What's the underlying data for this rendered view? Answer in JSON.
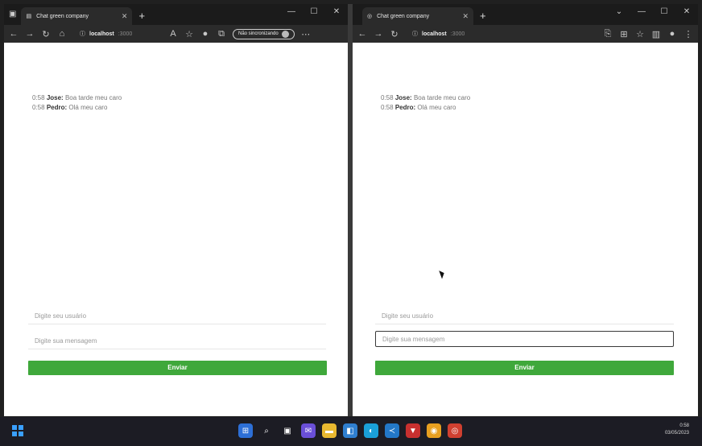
{
  "left_window": {
    "tab_title": "Chat green company",
    "address_host": "localhost",
    "address_port": ":3000",
    "sync_label": "Não sincronizando",
    "messages": [
      {
        "time": "0:58",
        "user": "Jose:",
        "text": "Boa tarde meu caro"
      },
      {
        "time": "0:58",
        "user": "Pedro:",
        "text": "Olá meu caro"
      }
    ],
    "username_placeholder": "Digite seu usuário",
    "message_placeholder": "Digite sua mensagem",
    "send_label": "Enviar"
  },
  "right_window": {
    "tab_title": "Chat green company",
    "address_host": "localhost",
    "address_port": ":3000",
    "messages": [
      {
        "time": "0:58",
        "user": "Jose:",
        "text": "Boa tarde meu caro"
      },
      {
        "time": "0:58",
        "user": "Pedro:",
        "text": "Olá meu caro"
      }
    ],
    "username_placeholder": "Digite seu usuário",
    "message_placeholder": "Digite sua mensagem",
    "send_label": "Enviar"
  },
  "taskbar": {
    "time": "0:58",
    "date": "03/05/2023"
  },
  "colors": {
    "send_button": "#3fa83b",
    "browser_chrome": "#2b2b2b",
    "taskbar": "#1c1c24"
  }
}
